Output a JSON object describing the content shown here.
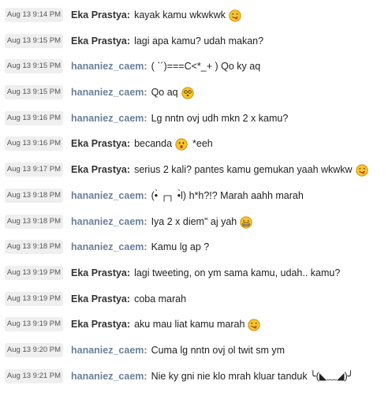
{
  "conversation": {
    "messages": [
      {
        "time": "Aug 13 9:14 PM",
        "sender": "Eka Prastya:",
        "sender_id": "eka",
        "text": "kayak kamu wkwkwk",
        "emoji": "tongue-face-icon"
      },
      {
        "time": "Aug 13 9:15 PM",
        "sender": "Eka Prastya:",
        "sender_id": "eka",
        "text": "lagi apa kamu? udah makan?",
        "emoji": ""
      },
      {
        "time": "Aug 13 9:15 PM",
        "sender": "hananiez_caem:",
        "sender_id": "han",
        "text": "( `´)===C<*_+ ) Qo ky aq",
        "emoji": ""
      },
      {
        "time": "Aug 13 9:15 PM",
        "sender": "hananiez_caem:",
        "sender_id": "han",
        "text": "Qo aq",
        "emoji": "dizzy-face-icon"
      },
      {
        "time": "Aug 13 9:16 PM",
        "sender": "hananiez_caem:",
        "sender_id": "han",
        "text": "Lg nntn ovj udh mkn 2 x kamu?",
        "emoji": ""
      },
      {
        "time": "Aug 13 9:16 PM",
        "sender": "Eka Prastya:",
        "sender_id": "eka",
        "text": "becanda",
        "emoji": "surprised-face-icon",
        "suffix": "*eeh"
      },
      {
        "time": "Aug 13 9:17 PM",
        "sender": "Eka Prastya:",
        "sender_id": "eka",
        "text": "serius 2 kali? pantes kamu gemukan yaah wkwkw",
        "emoji": "tongue-face-icon"
      },
      {
        "time": "Aug 13 9:18 PM",
        "sender": "hananiez_caem:",
        "sender_id": "han",
        "text": "(•̀ ┌┐ •̀l) h*h?!? Marah aahh marah",
        "emoji": ""
      },
      {
        "time": "Aug 13 9:18 PM",
        "sender": "hananiez_caem:",
        "sender_id": "han",
        "text": "Iya 2 x diem\" aj yah",
        "emoji": "grin-face-icon"
      },
      {
        "time": "Aug 13 9:18 PM",
        "sender": "hananiez_caem:",
        "sender_id": "han",
        "text": "Kamu lg ap ?",
        "emoji": ""
      },
      {
        "time": "Aug 13 9:19 PM",
        "sender": "Eka Prastya:",
        "sender_id": "eka",
        "text": "lagi tweeting, on ym sama kamu, udah.. kamu?",
        "emoji": ""
      },
      {
        "time": "Aug 13 9:19 PM",
        "sender": "Eka Prastya:",
        "sender_id": "eka",
        "text": "coba marah",
        "emoji": ""
      },
      {
        "time": "Aug 13 9:19 PM",
        "sender": "Eka Prastya:",
        "sender_id": "eka",
        "text": "aku mau liat kamu marah",
        "emoji": "tongue-face-icon"
      },
      {
        "time": "Aug 13 9:20 PM",
        "sender": "hananiez_caem:",
        "sender_id": "han",
        "text": "Cuma lg nntn ovj ol twit sm ym",
        "emoji": ""
      },
      {
        "time": "Aug 13 9:21 PM",
        "sender": "hananiez_caem:",
        "sender_id": "han",
        "text": "Nie ky gni nie klo mrah kluar tanduk ╰(◣﹏◢)╯",
        "emoji": ""
      }
    ]
  },
  "colors": {
    "eka_name": "#333333",
    "hananiez_name": "#6b7f99",
    "timestamp_bg": "#efefef",
    "emoji_yellow": "#f7c531"
  }
}
